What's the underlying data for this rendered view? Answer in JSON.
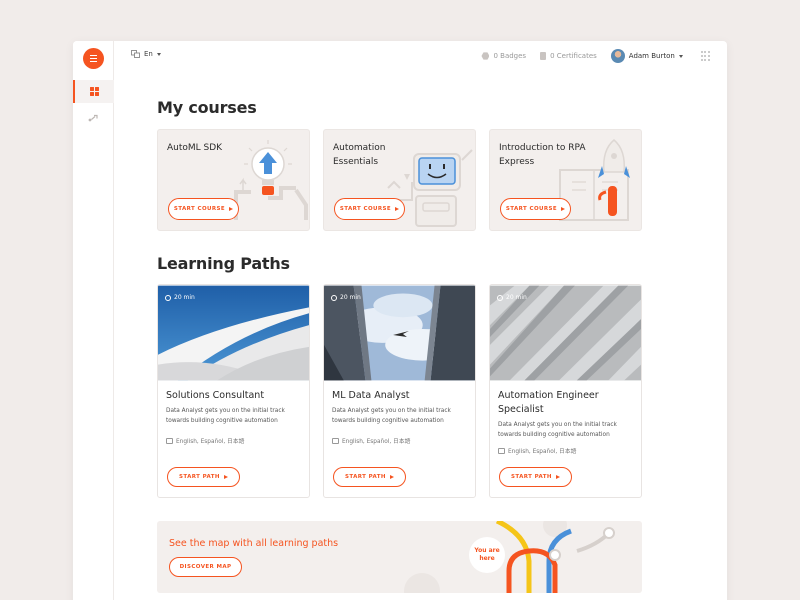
{
  "topbar": {
    "language": "En",
    "badges": "0 Badges",
    "certificates": "0 Certificates",
    "user_name": "Adam Burton"
  },
  "sections": {
    "my_courses": "My courses",
    "learning_paths": "Learning Paths"
  },
  "courses": [
    {
      "title": "AutoML SDK",
      "button": "START COURSE"
    },
    {
      "title": "Automation Essentials",
      "button": "START COURSE"
    },
    {
      "title": "Introduction to RPA Express",
      "button": "START COURSE"
    }
  ],
  "paths": [
    {
      "duration": "20 min",
      "title": "Solutions Consultant",
      "description": "Data Analyst gets you on the initial track towards building cognitive automation",
      "languages": "English, Español, 日本語",
      "button": "START PATH"
    },
    {
      "duration": "20 min",
      "title": "ML Data Analyst",
      "description": "Data Analyst gets you on the initial track towards building cognitive automation",
      "languages": "English, Español, 日本語",
      "button": "START PATH"
    },
    {
      "duration": "20 min",
      "title": "Automation Engineer Specialist",
      "description": "Data Analyst gets you on the initial track towards building cognitive automation",
      "languages": "English, Español, 日本語",
      "button": "START PATH"
    }
  ],
  "banner": {
    "title": "See the map with all learning paths",
    "button": "DISCOVER MAP",
    "marker_line1": "You are",
    "marker_line2": "here"
  },
  "colors": {
    "accent": "#f55420",
    "background": "#f1ecea",
    "card": "#f3efed"
  },
  "icons": {
    "menu": "menu-icon",
    "dashboard": "dashboard-icon",
    "paths": "route-icon",
    "language": "translate-icon",
    "badges": "badge-icon",
    "certificates": "certificate-icon",
    "apps": "apps-grid-icon",
    "duration": "timer-icon",
    "play": "play-icon"
  }
}
